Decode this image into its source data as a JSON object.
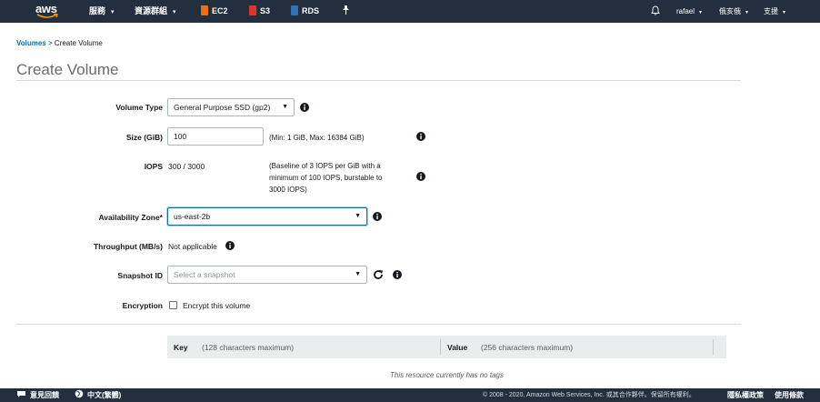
{
  "nav": {
    "logo_text": "aws",
    "services": "服務",
    "resource_groups": "資源群組",
    "ec2": "EC2",
    "s3": "S3",
    "rds": "RDS",
    "user": "rafael",
    "region": "俄亥俄",
    "support": "支援",
    "colors": {
      "bg": "#232f3e",
      "ec2": "#ec7211",
      "s3": "#e0352b",
      "rds": "#2e73b8"
    }
  },
  "breadcrumb": {
    "parent": "Volumes",
    "separator": ">",
    "current": "Create Volume"
  },
  "page_title": "Create Volume",
  "form": {
    "volume_type": {
      "label": "Volume Type",
      "value": "General Purpose SSD (gp2)"
    },
    "size": {
      "label": "Size (GiB)",
      "value": "100",
      "hint": "(Min: 1 GiB, Max: 16384 GiB)"
    },
    "iops": {
      "label": "IOPS",
      "value": "300 / 3000",
      "hint_lines": [
        "(Baseline of 3 IOPS per GiB with a",
        "minimum of 100 IOPS, burstable to",
        "3000 IOPS)"
      ]
    },
    "availability_zone": {
      "label": "Availability Zone*",
      "value": "us-east-2b"
    },
    "throughput": {
      "label": "Throughput (MB/s)",
      "value": "Not applicable"
    },
    "snapshot": {
      "label": "Snapshot ID",
      "placeholder": "Select a snapshot"
    },
    "encryption": {
      "label": "Encryption",
      "checkbox_label": "Encrypt this volume",
      "checked": false
    }
  },
  "tags": {
    "key_label": "Key",
    "key_hint": "(128 characters maximum)",
    "value_label": "Value",
    "value_hint": "(256 characters maximum)",
    "empty_message": "This resource currently has no tags"
  },
  "footer": {
    "feedback": "意見回饋",
    "language": "中文(繁體)",
    "copyright": "© 2008 - 2020, Amazon Web Services, Inc. 或其合作夥伴。保留所有權利。",
    "privacy": "隱私權政策",
    "terms": "使用條款"
  }
}
